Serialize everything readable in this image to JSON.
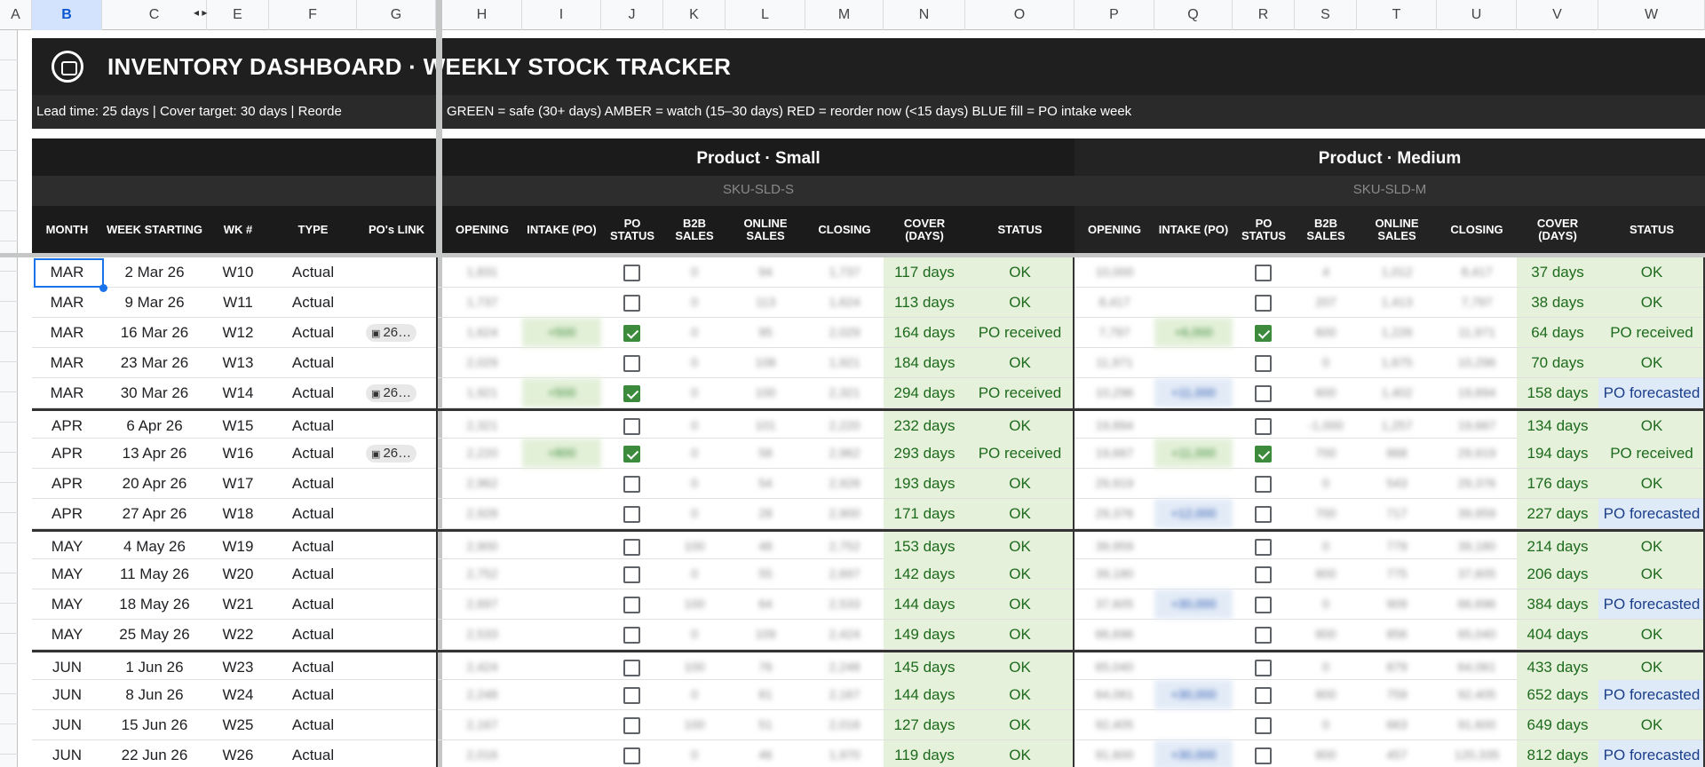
{
  "columns": [
    "A",
    "B",
    "C",
    "D",
    "E",
    "F",
    "G",
    "H",
    "I",
    "J",
    "K",
    "L",
    "M",
    "N",
    "O",
    "P",
    "Q",
    "R",
    "S",
    "T",
    "U",
    "V",
    "W"
  ],
  "title": "INVENTORY DASHBOARD  ·  WEEKLY STOCK TRACKER",
  "lead_text": "Lead time: 25 days  |  Cover target: 30 days  |  Reorde",
  "legend_text": "GREEN = safe (30+ days)   AMBER = watch (15–30 days)   RED = reorder now (<15 days)   BLUE fill = PO intake week",
  "left_headers": {
    "month": "MONTH",
    "week_starting": "WEEK STARTING",
    "wk": "WK #",
    "type": "TYPE",
    "po_link": "PO's LINK"
  },
  "products": [
    {
      "name": "Product  ·  Small",
      "sku": "SKU-SLD-S"
    },
    {
      "name": "Product  ·  Medium",
      "sku": "SKU-SLD-M"
    }
  ],
  "metric_headers": {
    "opening": "OPENING",
    "intake": "INTAKE (PO)",
    "po_status": "PO STATUS",
    "b2b": "B2B SALES",
    "online": "ONLINE SALES",
    "closing": "CLOSING",
    "cover": "COVER (DAYS)",
    "status": "STATUS"
  },
  "rows": [
    {
      "month": "MAR",
      "week": "2 Mar 26",
      "wk": "W10",
      "type": "Actual",
      "po": "",
      "s_open": "1,831",
      "s_intake": "",
      "s_po": false,
      "s_b2b": "0",
      "s_online": "94",
      "s_close": "1,737",
      "s_cover": "117 days",
      "s_status": "OK",
      "m_open": "10,000",
      "m_intake": "",
      "m_po": false,
      "m_b2b": "4",
      "m_online": "1,012",
      "m_close": "8,417",
      "m_cover": "37 days",
      "m_status": "OK"
    },
    {
      "month": "MAR",
      "week": "9 Mar 26",
      "wk": "W11",
      "type": "Actual",
      "po": "",
      "s_open": "1,737",
      "s_intake": "",
      "s_po": false,
      "s_b2b": "0",
      "s_online": "113",
      "s_close": "1,624",
      "s_cover": "113 days",
      "s_status": "OK",
      "m_open": "8,417",
      "m_intake": "",
      "m_po": false,
      "m_b2b": "207",
      "m_online": "1,413",
      "m_close": "7,797",
      "m_cover": "38 days",
      "m_status": "OK"
    },
    {
      "month": "MAR",
      "week": "16 Mar 26",
      "wk": "W12",
      "type": "Actual",
      "po": "26…",
      "s_open": "1,624",
      "s_intake": "+500",
      "s_po": true,
      "s_b2b": "0",
      "s_online": "95",
      "s_close": "2,029",
      "s_cover": "164 days",
      "s_status": "PO received",
      "m_open": "7,797",
      "m_intake": "+6,000",
      "m_po": true,
      "m_b2b": "600",
      "m_online": "1,226",
      "m_close": "11,971",
      "m_cover": "64 days",
      "m_status": "PO received"
    },
    {
      "month": "MAR",
      "week": "23 Mar 26",
      "wk": "W13",
      "type": "Actual",
      "po": "",
      "s_open": "2,029",
      "s_intake": "",
      "s_po": false,
      "s_b2b": "0",
      "s_online": "108",
      "s_close": "1,921",
      "s_cover": "184 days",
      "s_status": "OK",
      "m_open": "11,971",
      "m_intake": "",
      "m_po": false,
      "m_b2b": "0",
      "m_online": "1,675",
      "m_close": "10,296",
      "m_cover": "70 days",
      "m_status": "OK"
    },
    {
      "month": "MAR",
      "week": "30 Mar 26",
      "wk": "W14",
      "type": "Actual",
      "po": "26…",
      "s_open": "1,921",
      "s_intake": "+500",
      "s_po": true,
      "s_b2b": "0",
      "s_online": "100",
      "s_close": "2,321",
      "s_cover": "294 days",
      "s_status": "PO received",
      "m_open": "10,296",
      "m_intake": "+11,000",
      "m_po": false,
      "m_b2b": "600",
      "m_online": "1,402",
      "m_close": "19,894",
      "m_cover": "158 days",
      "m_status": "PO forecasted"
    },
    {
      "month": "APR",
      "week": "6 Apr 26",
      "wk": "W15",
      "type": "Actual",
      "po": "",
      "s_open": "2,321",
      "s_intake": "",
      "s_po": false,
      "s_b2b": "0",
      "s_online": "101",
      "s_close": "2,220",
      "s_cover": "232 days",
      "s_status": "OK",
      "m_open": "19,894",
      "m_intake": "",
      "m_po": false,
      "m_b2b": "-1,000",
      "m_online": "1,257",
      "m_close": "19,667",
      "m_cover": "134 days",
      "m_status": "OK"
    },
    {
      "month": "APR",
      "week": "13 Apr 26",
      "wk": "W16",
      "type": "Actual",
      "po": "26…",
      "s_open": "2,220",
      "s_intake": "+800",
      "s_po": true,
      "s_b2b": "0",
      "s_online": "58",
      "s_close": "2,962",
      "s_cover": "293 days",
      "s_status": "PO received",
      "m_open": "19,667",
      "m_intake": "+11,000",
      "m_po": true,
      "m_b2b": "700",
      "m_online": "868",
      "m_close": "29,919",
      "m_cover": "194 days",
      "m_status": "PO received"
    },
    {
      "month": "APR",
      "week": "20 Apr 26",
      "wk": "W17",
      "type": "Actual",
      "po": "",
      "s_open": "2,962",
      "s_intake": "",
      "s_po": false,
      "s_b2b": "0",
      "s_online": "54",
      "s_close": "2,928",
      "s_cover": "193 days",
      "s_status": "OK",
      "m_open": "29,919",
      "m_intake": "",
      "m_po": false,
      "m_b2b": "0",
      "m_online": "543",
      "m_close": "29,376",
      "m_cover": "176 days",
      "m_status": "OK"
    },
    {
      "month": "APR",
      "week": "27 Apr 26",
      "wk": "W18",
      "type": "Actual",
      "po": "",
      "s_open": "2,928",
      "s_intake": "",
      "s_po": false,
      "s_b2b": "0",
      "s_online": "28",
      "s_close": "2,900",
      "s_cover": "171 days",
      "s_status": "OK",
      "m_open": "29,376",
      "m_intake": "+12,000",
      "m_po": false,
      "m_b2b": "700",
      "m_online": "717",
      "m_close": "39,959",
      "m_cover": "227 days",
      "m_status": "PO forecasted"
    },
    {
      "month": "MAY",
      "week": "4 May 26",
      "wk": "W19",
      "type": "Actual",
      "po": "",
      "s_open": "2,900",
      "s_intake": "",
      "s_po": false,
      "s_b2b": "100",
      "s_online": "48",
      "s_close": "2,752",
      "s_cover": "153 days",
      "s_status": "OK",
      "m_open": "39,959",
      "m_intake": "",
      "m_po": false,
      "m_b2b": "0",
      "m_online": "779",
      "m_close": "39,180",
      "m_cover": "214 days",
      "m_status": "OK"
    },
    {
      "month": "MAY",
      "week": "11 May 26",
      "wk": "W20",
      "type": "Actual",
      "po": "",
      "s_open": "2,752",
      "s_intake": "",
      "s_po": false,
      "s_b2b": "0",
      "s_online": "55",
      "s_close": "2,697",
      "s_cover": "142 days",
      "s_status": "OK",
      "m_open": "39,180",
      "m_intake": "",
      "m_po": false,
      "m_b2b": "800",
      "m_online": "775",
      "m_close": "37,605",
      "m_cover": "206 days",
      "m_status": "OK"
    },
    {
      "month": "MAY",
      "week": "18 May 26",
      "wk": "W21",
      "type": "Actual",
      "po": "",
      "s_open": "2,697",
      "s_intake": "",
      "s_po": false,
      "s_b2b": "100",
      "s_online": "64",
      "s_close": "2,533",
      "s_cover": "144 days",
      "s_status": "OK",
      "m_open": "37,605",
      "m_intake": "+30,000",
      "m_po": false,
      "m_b2b": "0",
      "m_online": "909",
      "m_close": "66,696",
      "m_cover": "384 days",
      "m_status": "PO forecasted"
    },
    {
      "month": "MAY",
      "week": "25 May 26",
      "wk": "W22",
      "type": "Actual",
      "po": "",
      "s_open": "2,533",
      "s_intake": "",
      "s_po": false,
      "s_b2b": "0",
      "s_online": "109",
      "s_close": "2,424",
      "s_cover": "149 days",
      "s_status": "OK",
      "m_open": "66,696",
      "m_intake": "",
      "m_po": false,
      "m_b2b": "800",
      "m_online": "856",
      "m_close": "65,040",
      "m_cover": "404 days",
      "m_status": "OK"
    },
    {
      "month": "JUN",
      "week": "1 Jun 26",
      "wk": "W23",
      "type": "Actual",
      "po": "",
      "s_open": "2,424",
      "s_intake": "",
      "s_po": false,
      "s_b2b": "100",
      "s_online": "76",
      "s_close": "2,248",
      "s_cover": "145 days",
      "s_status": "OK",
      "m_open": "65,040",
      "m_intake": "",
      "m_po": false,
      "m_b2b": "0",
      "m_online": "879",
      "m_close": "64,061",
      "m_cover": "433 days",
      "m_status": "OK"
    },
    {
      "month": "JUN",
      "week": "8 Jun 26",
      "wk": "W24",
      "type": "Actual",
      "po": "",
      "s_open": "2,248",
      "s_intake": "",
      "s_po": false,
      "s_b2b": "0",
      "s_online": "81",
      "s_close": "2,167",
      "s_cover": "144 days",
      "s_status": "OK",
      "m_open": "64,061",
      "m_intake": "+30,000",
      "m_po": false,
      "m_b2b": "800",
      "m_online": "759",
      "m_close": "92,405",
      "m_cover": "652 days",
      "m_status": "PO forecasted"
    },
    {
      "month": "JUN",
      "week": "15 Jun 26",
      "wk": "W25",
      "type": "Actual",
      "po": "",
      "s_open": "2,167",
      "s_intake": "",
      "s_po": false,
      "s_b2b": "100",
      "s_online": "51",
      "s_close": "2,016",
      "s_cover": "127 days",
      "s_status": "OK",
      "m_open": "92,405",
      "m_intake": "",
      "m_po": false,
      "m_b2b": "0",
      "m_online": "663",
      "m_close": "91,600",
      "m_cover": "649 days",
      "m_status": "OK"
    },
    {
      "month": "JUN",
      "week": "22 Jun 26",
      "wk": "W26",
      "type": "Actual",
      "po": "",
      "s_open": "2,016",
      "s_intake": "",
      "s_po": false,
      "s_b2b": "0",
      "s_online": "46",
      "s_close": "1,970",
      "s_cover": "119 days",
      "s_status": "OK",
      "m_open": "91,600",
      "m_intake": "+30,000",
      "m_po": false,
      "m_b2b": "800",
      "m_online": "457",
      "m_close": "120,335",
      "m_cover": "812 days",
      "m_status": "PO forecasted"
    }
  ]
}
